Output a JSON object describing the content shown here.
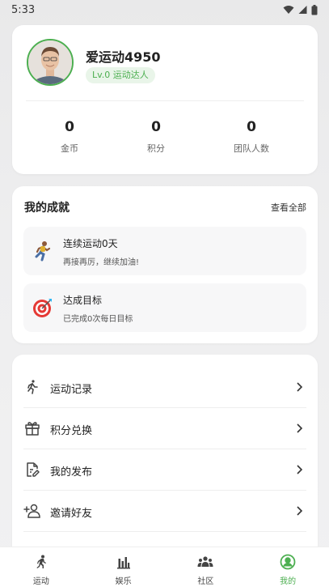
{
  "status_bar": {
    "time": "5:33"
  },
  "profile": {
    "username": "爱运动4950",
    "level": "Lv.0 运动达人",
    "stats": [
      {
        "value": "0",
        "label": "金币"
      },
      {
        "value": "0",
        "label": "积分"
      },
      {
        "value": "0",
        "label": "团队人数"
      }
    ]
  },
  "achievements": {
    "title": "我的成就",
    "view_all": "查看全部",
    "items": [
      {
        "name": "连续运动0天",
        "desc": "再接再厉，继续加油!",
        "icon": "running-person-icon"
      },
      {
        "name": "达成目标",
        "desc": "已完成0次每日目标",
        "icon": "target-icon"
      }
    ]
  },
  "menu": {
    "items": [
      {
        "label": "运动记录",
        "icon": "walking-icon"
      },
      {
        "label": "积分兑换",
        "icon": "gift-icon"
      },
      {
        "label": "我的发布",
        "icon": "edit-document-icon"
      },
      {
        "label": "邀请好友",
        "icon": "add-user-icon"
      }
    ]
  },
  "tabbar": {
    "tabs": [
      {
        "label": "运动",
        "icon": "run-icon"
      },
      {
        "label": "娱乐",
        "icon": "bar-chart-icon"
      },
      {
        "label": "社区",
        "icon": "group-icon"
      },
      {
        "label": "我的",
        "icon": "profile-icon",
        "active": true
      }
    ]
  },
  "colors": {
    "accent": "#4caf50",
    "badge_bg": "#e9f5e9"
  }
}
